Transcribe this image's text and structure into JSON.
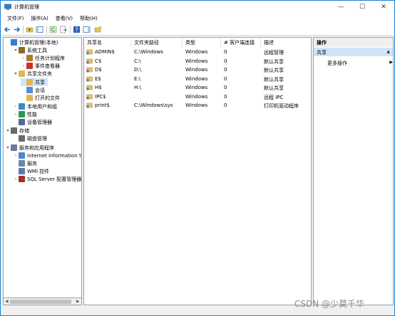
{
  "window": {
    "title": "计算机管理",
    "controls": {
      "minimize": "—",
      "maximize": "☐",
      "close": "✕"
    }
  },
  "menubar": [
    "文件(F)",
    "操作(A)",
    "查看(V)",
    "帮助(H)"
  ],
  "tree": [
    {
      "label": "计算机管理(本地)",
      "icon": "computer-management-icon",
      "arrow": ""
    },
    {
      "label": "系统工具",
      "icon": "system-tools-icon",
      "arrow": "▾"
    },
    {
      "label": "任务计划程序",
      "icon": "task-scheduler-icon",
      "arrow": "›"
    },
    {
      "label": "事件查看器",
      "icon": "event-viewer-icon",
      "arrow": "›"
    },
    {
      "label": "共享文件夹",
      "icon": "shared-folder-icon",
      "arrow": "▾"
    },
    {
      "label": "共享",
      "icon": "shares-icon",
      "arrow": ""
    },
    {
      "label": "会话",
      "icon": "sessions-icon",
      "arrow": ""
    },
    {
      "label": "打开的文件",
      "icon": "open-files-icon",
      "arrow": ""
    },
    {
      "label": "本地用户和组",
      "icon": "local-users-icon",
      "arrow": "›"
    },
    {
      "label": "性能",
      "icon": "performance-icon",
      "arrow": "›"
    },
    {
      "label": "设备管理器",
      "icon": "device-manager-icon",
      "arrow": ""
    },
    {
      "label": "存储",
      "icon": "storage-icon",
      "arrow": "▾"
    },
    {
      "label": "磁盘管理",
      "icon": "disk-management-icon",
      "arrow": ""
    },
    {
      "label": "服务和应用程序",
      "icon": "services-apps-icon",
      "arrow": "▾"
    },
    {
      "label": "Internet Information S",
      "icon": "iis-icon",
      "arrow": "›"
    },
    {
      "label": "服务",
      "icon": "services-icon",
      "arrow": ""
    },
    {
      "label": "WMI 控件",
      "icon": "wmi-icon",
      "arrow": ""
    },
    {
      "label": "SQL Server 配置管理器",
      "icon": "sql-server-icon",
      "arrow": "›"
    }
  ],
  "table": {
    "columns": [
      "共享名",
      "文件夹路径",
      "类型",
      "# 客户端连接",
      "描述"
    ],
    "sort_indicator": "^",
    "rows": [
      {
        "name": "ADMIN$",
        "path": "C:\\Windows",
        "type": "Windows",
        "clients": "0",
        "desc": "远程管理"
      },
      {
        "name": "C$",
        "path": "C:\\",
        "type": "Windows",
        "clients": "0",
        "desc": "默认共享"
      },
      {
        "name": "D$",
        "path": "D:\\",
        "type": "Windows",
        "clients": "0",
        "desc": "默认共享"
      },
      {
        "name": "E$",
        "path": "E:\\",
        "type": "Windows",
        "clients": "0",
        "desc": "默认共享"
      },
      {
        "name": "H$",
        "path": "H:\\",
        "type": "Windows",
        "clients": "0",
        "desc": "默认共享"
      },
      {
        "name": "IPC$",
        "path": "",
        "type": "Windows",
        "clients": "0",
        "desc": "远程 IPC"
      },
      {
        "name": "print$",
        "path": "C:\\Windows\\syst...",
        "type": "Windows",
        "clients": "0",
        "desc": "打印机驱动程序"
      }
    ]
  },
  "actions": {
    "title": "操作",
    "section": "共享",
    "more": "更多操作",
    "section_arrow": "▲",
    "more_arrow": "▶"
  },
  "watermark": "CSDN @少莫千华",
  "colors": {
    "accent": "#1883d7",
    "selection": "#cce8ff",
    "action_header": "#cfe4f8"
  }
}
